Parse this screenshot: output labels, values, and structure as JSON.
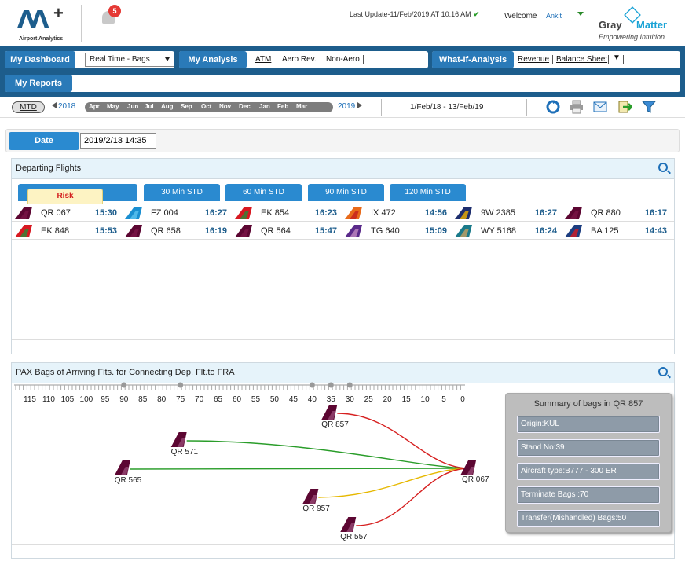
{
  "header": {
    "logo_text": "Airport Analytics",
    "notification_count": "5",
    "last_update": "Last Update-11/Feb/2019 AT 10:16 AM",
    "welcome": "Welcome",
    "user": "Ankit",
    "brand_left": "Gray",
    "brand_right": "Matter",
    "brand_tagline": "Empowering Intuition"
  },
  "nav": {
    "dashboard_title": "My Dashboard",
    "dashboard_select": "Real Time - Bags",
    "analysis_title": "My Analysis",
    "analysis_links": [
      "ATM",
      "Aero Rev.",
      "Non-Aero"
    ],
    "whatif_title": "What-If-Analysis",
    "whatif_links": [
      "Revenue",
      "Balance Sheet"
    ],
    "reports_title": "My Reports"
  },
  "timeline": {
    "mtd": "MTD",
    "year_start": "2018",
    "months": [
      "Apr",
      "May",
      "Jun",
      "Jul",
      "Aug",
      "Sep",
      "Oct",
      "Nov",
      "Dec",
      "Jan",
      "Feb",
      "Mar"
    ],
    "year_end": "2019",
    "date_range": "1/Feb/18 - 13/Feb/19"
  },
  "date_filter": {
    "label": "Date",
    "value": "2019/2/13 14:35"
  },
  "departing": {
    "title": "Departing Flights",
    "tabs": [
      "Risk",
      "30 Min STD",
      "60 Min STD",
      "90 Min STD",
      "120 Min STD"
    ],
    "flights_row1": [
      {
        "code": "QR 067",
        "time": "15:30",
        "airline": "qatar"
      },
      {
        "code": "FZ 004",
        "time": "16:27",
        "airline": "flydubai"
      },
      {
        "code": "EK 854",
        "time": "16:23",
        "airline": "emirates"
      },
      {
        "code": "IX 472",
        "time": "14:56",
        "airline": "airindia"
      },
      {
        "code": "9W 2385",
        "time": "16:27",
        "airline": "jet"
      },
      {
        "code": "QR 880",
        "time": "16:17",
        "airline": "qatar"
      }
    ],
    "flights_row2": [
      {
        "code": "EK 848",
        "time": "15:53",
        "airline": "emirates"
      },
      {
        "code": "QR 658",
        "time": "16:19",
        "airline": "qatar"
      },
      {
        "code": "QR 564",
        "time": "15:47",
        "airline": "qatar"
      },
      {
        "code": "TG 640",
        "time": "15:09",
        "airline": "thai"
      },
      {
        "code": "WY 5168",
        "time": "16:24",
        "airline": "oman"
      },
      {
        "code": "BA 125",
        "time": "14:43",
        "airline": "ba"
      }
    ]
  },
  "pax": {
    "title": "PAX Bags of Arriving Flts. for Connecting Dep. Flt.to FRA",
    "scale_labels": [
      "115",
      "110",
      "105",
      "100",
      "95",
      "90",
      "85",
      "80",
      "75",
      "70",
      "65",
      "60",
      "55",
      "50",
      "45",
      "40",
      "35",
      "30",
      "25",
      "20",
      "15",
      "10",
      "5",
      "0"
    ],
    "arriving": [
      {
        "code": "QR 857",
        "minutes": 35,
        "status": "red"
      },
      {
        "code": "QR 571",
        "minutes": 75,
        "status": "green"
      },
      {
        "code": "QR 565",
        "minutes": 90,
        "status": "green"
      },
      {
        "code": "QR 957",
        "minutes": 40,
        "status": "yellow"
      },
      {
        "code": "QR 557",
        "minutes": 30,
        "status": "red"
      }
    ],
    "departing_flight": "QR 067",
    "colors": {
      "red": "#d62020",
      "green": "#2a9d2a",
      "yellow": "#e6b800"
    },
    "summary": {
      "title": "Summary of bags in QR 857",
      "items": [
        "Origin:KUL",
        "Stand No:39",
        "Aircraft type:B777 - 300 ER",
        "Terminate Bags :70",
        "Transfer(Mishandled) Bags:50"
      ]
    }
  }
}
